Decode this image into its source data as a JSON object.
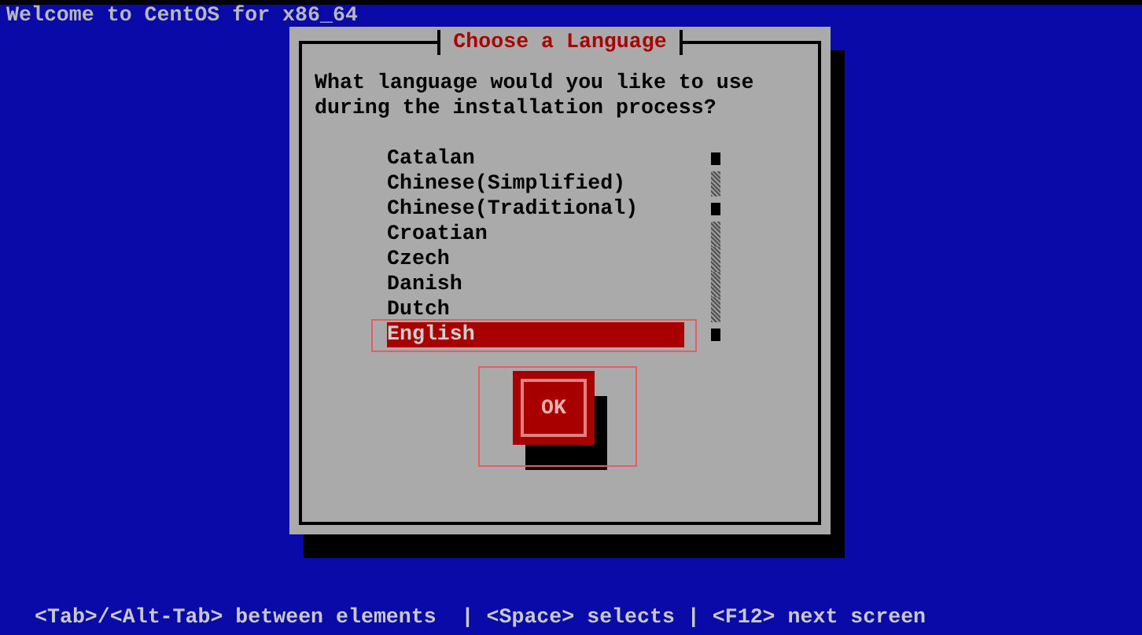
{
  "top_bar": {
    "title": "Welcome to CentOS for x86_64"
  },
  "dialog": {
    "title": "Choose a Language",
    "prompt": "What language would you like to use during the installation process?",
    "languages": [
      {
        "label": "Catalan",
        "selected": false
      },
      {
        "label": "Chinese(Simplified)",
        "selected": false
      },
      {
        "label": "Chinese(Traditional)",
        "selected": false
      },
      {
        "label": "Croatian",
        "selected": false
      },
      {
        "label": "Czech",
        "selected": false
      },
      {
        "label": "Danish",
        "selected": false
      },
      {
        "label": "Dutch",
        "selected": false
      },
      {
        "label": "English",
        "selected": true
      }
    ],
    "ok_button": {
      "label": "OK"
    }
  },
  "status_bar": {
    "text": "<Tab>/<Alt-Tab> between elements  | <Space> selects | <F12> next screen"
  }
}
